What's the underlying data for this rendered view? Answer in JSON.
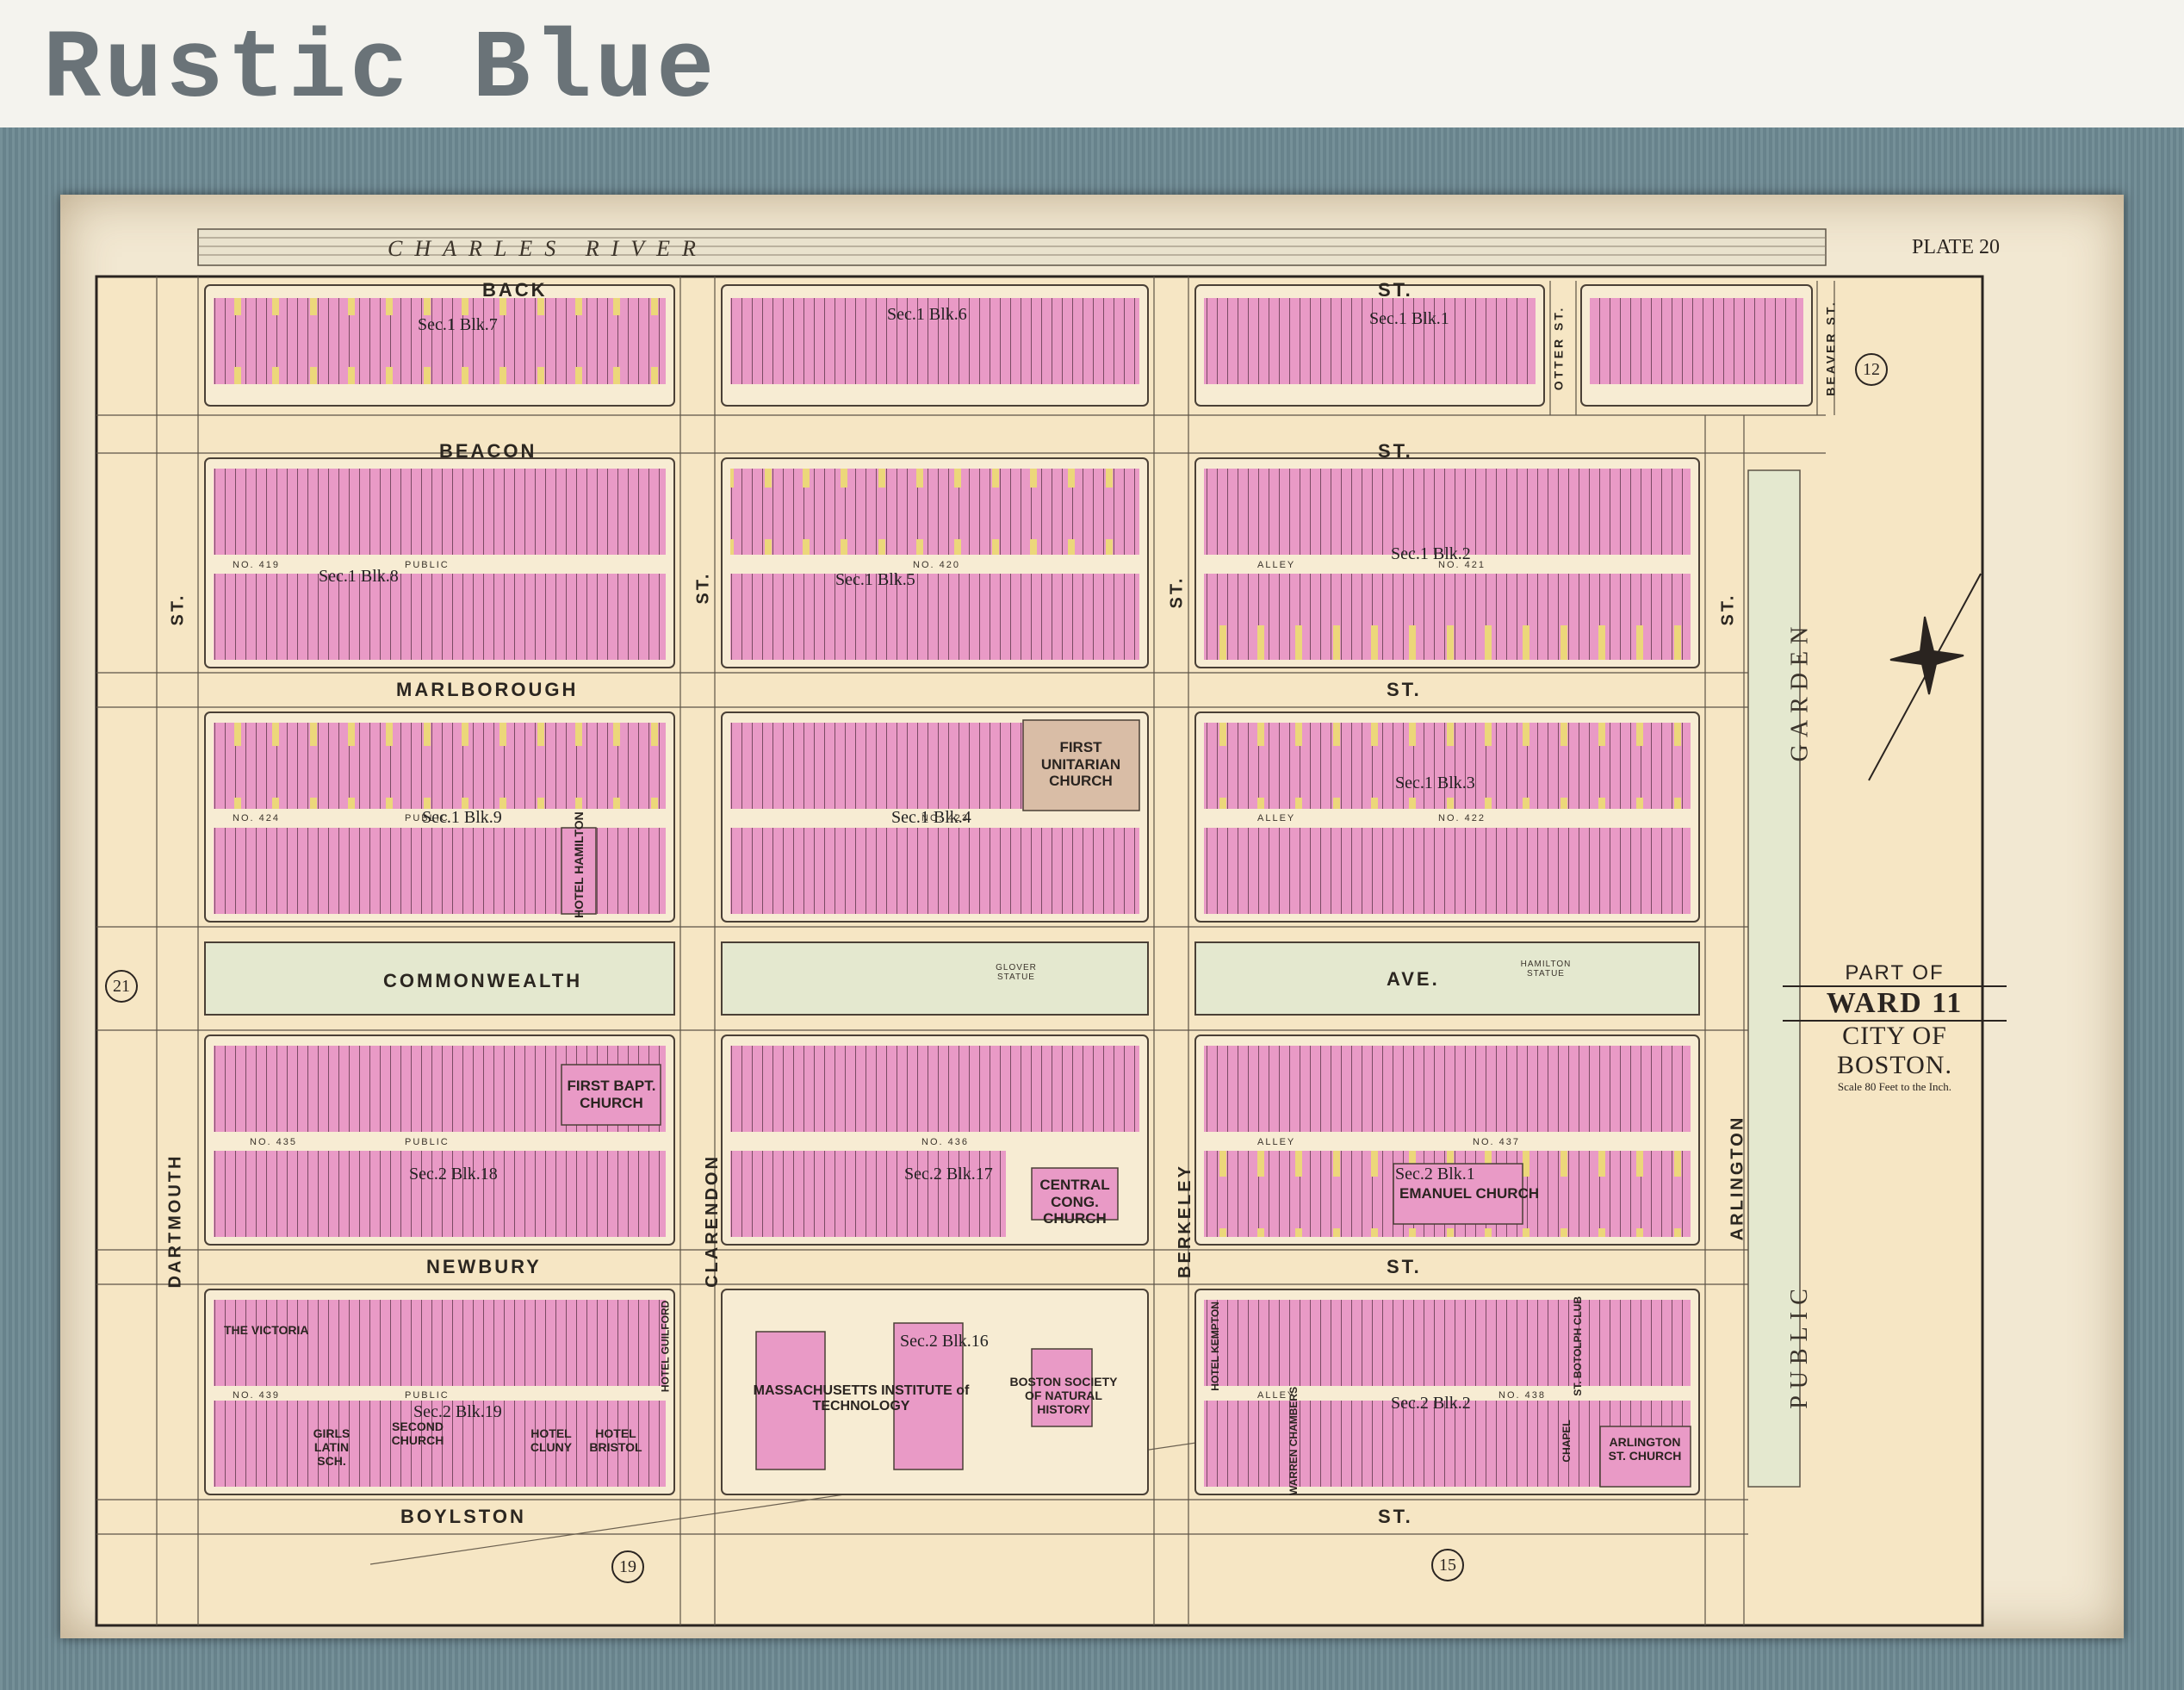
{
  "header": {
    "title": "Rustic Blue"
  },
  "map": {
    "river": "CHARLES RIVER",
    "plate": "PLATE 20",
    "streets_h": {
      "back": "BACK",
      "back_st": "ST.",
      "beacon": "BEACON",
      "beacon_st": "ST.",
      "marlborough": "MARLBOROUGH",
      "marlborough_st": "ST.",
      "commonwealth": "COMMONWEALTH",
      "commonwealth_ave": "AVE.",
      "newbury": "NEWBURY",
      "newbury_st": "ST.",
      "boylston": "BOYLSTON",
      "boylston_st": "ST."
    },
    "streets_v": {
      "dartmouth": "DARTMOUTH",
      "dartmouth_st": "ST.",
      "clarendon": "CLARENDON",
      "clarendon_st": "ST.",
      "berkeley": "BERKELEY",
      "berkeley_st": "ST.",
      "arlington": "ARLINGTON",
      "arlington_st": "ST.",
      "otter": "OTTER ST.",
      "beaver": "BEAVER ST."
    },
    "garden": {
      "garden": "GARDEN",
      "public": "PUBLIC"
    },
    "sections": {
      "s1b7": "Sec.1 Blk.7",
      "s1b6": "Sec.1 Blk.6",
      "s1b1": "Sec.1 Blk.1",
      "s1b8": "Sec.1 Blk.8",
      "s1b5": "Sec.1 Blk.5",
      "s1b2": "Sec.1 Blk.2",
      "s1b9": "Sec.1 Blk.9",
      "s1b4": "Sec.1 Blk.4",
      "s1b3": "Sec.1 Blk.3",
      "s2b18": "Sec.2 Blk.18",
      "s2b17": "Sec.2 Blk.17",
      "s2b1": "Sec.2 Blk.1",
      "s2b19": "Sec.2 Blk.19",
      "s2b16": "Sec.2 Blk.16",
      "s2b2": "Sec.2 Blk.2"
    },
    "buildings": {
      "first_unitarian": "FIRST UNITARIAN CHURCH",
      "hotel_hamilton": "HOTEL HAMILTON",
      "first_bapt": "FIRST BAPT. CHURCH",
      "central_cong": "CENTRAL CONG. CHURCH",
      "emanuel": "EMANUEL CHURCH",
      "victoria": "THE VICTORIA",
      "girls_latin": "GIRLS LATIN SCH.",
      "second_church": "SECOND CHURCH",
      "hotel_cluny": "HOTEL CLUNY",
      "hotel_bristol": "HOTEL BRISTOL",
      "hotel_guilford": "HOTEL GUILFORD",
      "mit": "MASSACHUSETTS INSTITUTE of TECHNOLOGY",
      "boston_society": "BOSTON SOCIETY OF NATURAL HISTORY",
      "hotel_kempton": "HOTEL KEMPTON",
      "warren_chambers": "WARREN CHAMBERS",
      "st_botolph": "ST. BOTOLPH CLUB",
      "chapel": "CHAPEL",
      "arlington_church": "ARLINGTON ST. CHURCH"
    },
    "alleys": {
      "public": "PUBLIC",
      "alley": "ALLEY",
      "no419": "NO. 419",
      "no420": "NO. 420",
      "no421": "NO. 421",
      "no424": "NO. 424",
      "no423": "NO. 423",
      "no422": "NO. 422",
      "no435": "NO. 435",
      "no436": "NO. 436",
      "no437": "NO. 437",
      "no439": "NO. 439",
      "no438": "NO. 438"
    },
    "statues": {
      "glover": "GLOVER STATUE",
      "hamilton": "HAMILTON STATUE"
    },
    "ward": {
      "part_of": "PART OF",
      "ward": "WARD 11",
      "city": "CITY OF BOSTON.",
      "scale": "Scale 80 Feet to the Inch."
    },
    "plate_numbers": {
      "p12": "12",
      "p21": "21",
      "p19": "19",
      "p15": "15"
    }
  },
  "colors": {
    "frame": "#6e8a93",
    "paper": "#f2e8d2",
    "lot_pink": "#e99ac6",
    "lot_yellow": "#ecd77a",
    "park_green": "#e4e8cf"
  }
}
